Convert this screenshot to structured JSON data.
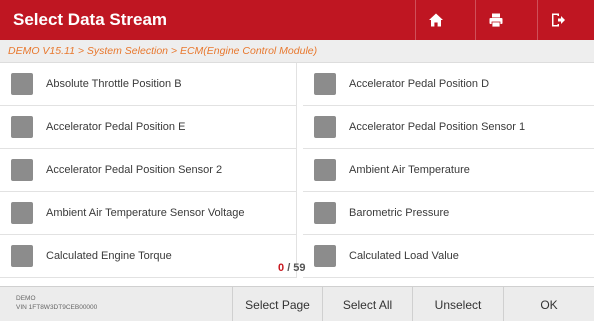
{
  "header": {
    "title": "Select Data Stream",
    "icons": [
      "home-icon",
      "print-icon",
      "exit-icon"
    ],
    "bar_color": "#bf1622"
  },
  "breadcrumb": "DEMO V15.11 > System Selection > ECM(Engine Control Module)",
  "items": [
    {
      "label": "Absolute Throttle Position B",
      "checked": false
    },
    {
      "label": "Accelerator Pedal Position D",
      "checked": false
    },
    {
      "label": "Accelerator Pedal Position E",
      "checked": false
    },
    {
      "label": "Accelerator Pedal Position Sensor 1",
      "checked": false
    },
    {
      "label": "Accelerator Pedal Position Sensor 2",
      "checked": false
    },
    {
      "label": "Ambient Air Temperature",
      "checked": false
    },
    {
      "label": "Ambient Air Temperature Sensor Voltage",
      "checked": false
    },
    {
      "label": "Barometric Pressure",
      "checked": false
    },
    {
      "label": "Calculated Engine Torque",
      "checked": false
    },
    {
      "label": "Calculated Load Value",
      "checked": false
    }
  ],
  "counter": {
    "selected": "0",
    "total": "/ 59"
  },
  "footer": {
    "vehicle": "DEMO",
    "vin": "VIN 1FT8W3DT9CEB00000",
    "buttons": [
      "Select Page",
      "Select All",
      "Unselect",
      "OK"
    ]
  },
  "colors": {
    "accent": "#bf1622",
    "breadcrumb_text": "#e8782e",
    "checkbox": "#8c8c8c"
  }
}
